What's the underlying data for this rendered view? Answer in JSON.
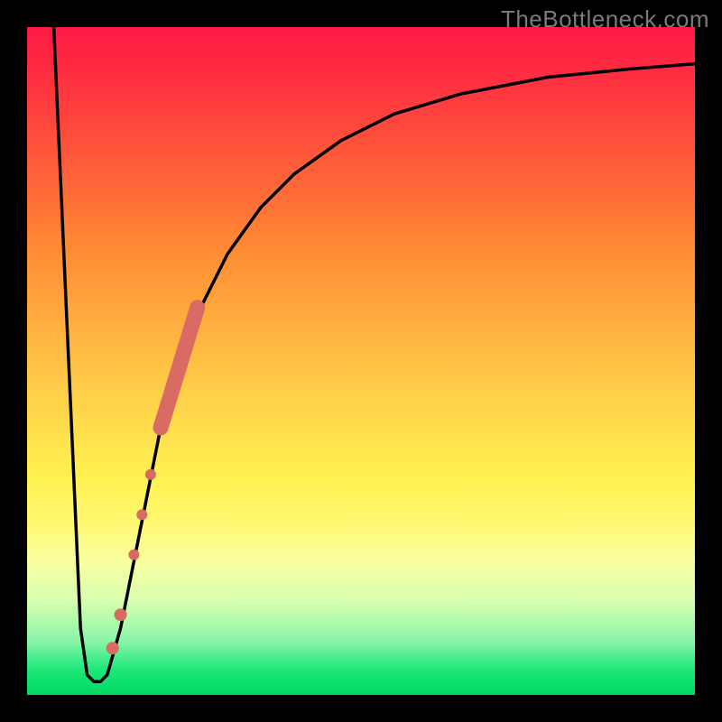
{
  "watermark": "TheBottleneck.com",
  "colors": {
    "curve_stroke": "#000000",
    "marker_fill": "#d96b62",
    "marker_fill_light": "#e47b72"
  },
  "chart_data": {
    "type": "line",
    "title": "",
    "xlabel": "",
    "ylabel": "",
    "xlim": [
      0,
      100
    ],
    "ylim": [
      0,
      100
    ],
    "grid": false,
    "legend": false,
    "series": [
      {
        "name": "curve",
        "x": [
          4,
          6,
          8,
          9,
          10,
          11,
          12,
          14,
          16,
          18,
          20,
          23,
          26,
          30,
          35,
          40,
          47,
          55,
          65,
          78,
          90,
          100
        ],
        "y": [
          100,
          55,
          10,
          3,
          2,
          2,
          3,
          10,
          20,
          30,
          40,
          50,
          58,
          66,
          73,
          78,
          83,
          87,
          90,
          92.5,
          93.7,
          94.5
        ]
      }
    ],
    "markers": [
      {
        "segment_start_x": 20,
        "segment_start_y": 40,
        "segment_end_x": 25.5,
        "segment_end_y": 58,
        "type": "thick-segment"
      },
      {
        "x": 18.5,
        "y": 33,
        "r": 6,
        "type": "dot"
      },
      {
        "x": 17.2,
        "y": 27,
        "r": 6,
        "type": "dot"
      },
      {
        "x": 16.0,
        "y": 21,
        "r": 6,
        "type": "dot"
      },
      {
        "x": 14.0,
        "y": 12,
        "r": 7,
        "type": "dot"
      },
      {
        "x": 12.8,
        "y": 7,
        "r": 7,
        "type": "dot"
      }
    ]
  }
}
